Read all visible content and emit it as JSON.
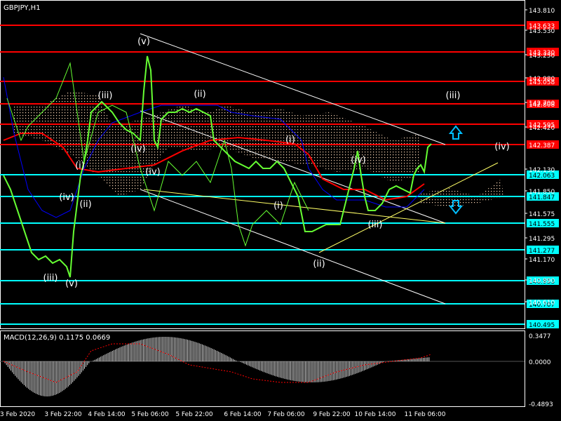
{
  "symbol_title": "GBPJPY,H1",
  "main_price_ticks": [
    "143.810",
    "143.530",
    "143.250",
    "142.980",
    "142.700",
    "142.420",
    "142.130",
    "141.850",
    "141.575",
    "141.295",
    "141.170",
    "140.890",
    "140.610"
  ],
  "level_lines": [
    {
      "price": "143.633",
      "color": "#ff0000"
    },
    {
      "price": "143.330",
      "color": "#ff0000"
    },
    {
      "price": "143.058",
      "color": "#ff0000"
    },
    {
      "price": "142.808",
      "color": "#ff0000"
    },
    {
      "price": "142.595",
      "color": "#ff0000"
    },
    {
      "price": "142.387",
      "color": "#ff0000"
    },
    {
      "price": "142.063",
      "color": "#00ffff"
    },
    {
      "price": "141.847",
      "color": "#00ffff"
    },
    {
      "price": "141.555",
      "color": "#00ffff"
    },
    {
      "price": "141.277",
      "color": "#00ffff"
    },
    {
      "price": "140.953",
      "color": "#00ffff"
    },
    {
      "price": "140.707",
      "color": "#00ffff"
    },
    {
      "price": "140.495",
      "color": "#00ffff"
    }
  ],
  "wave_labels": [
    "(v)",
    "(iii)",
    "(ii)",
    "(iv)",
    "(i)",
    "(iv)",
    "(iii)",
    "(v)",
    "(ii)",
    "(iv)",
    "(i)",
    "(iv)",
    "(i)",
    "(ii)",
    "(iii)",
    "(v)",
    "(iii)",
    "(iv)"
  ],
  "macd": {
    "label": "MACD(12,26,9) 0.1175 0.0669",
    "ticks": [
      "0.3477",
      "0.0000",
      "-0.4893"
    ]
  },
  "time_labels": [
    "3 Feb 2020",
    "3 Feb 22:00",
    "4 Feb 14:00",
    "5 Feb 06:00",
    "5 Feb 22:00",
    "6 Feb 14:00",
    "7 Feb 06:00",
    "9 Feb 22:00",
    "10 Feb 14:00",
    "11 Feb 06:00"
  ],
  "colors": {
    "background": "#000000",
    "grid": "#ffffff",
    "price": "#66ff33",
    "ichimoku_cloud": "#ffdab9",
    "kijun": "#ff0000",
    "tenkan": "#0000ff",
    "trendline": "#ffffff",
    "yellow_line": "#ffff66",
    "arrow": "#00bfff"
  },
  "icons": [
    "arrow-up-icon",
    "arrow-down-icon"
  ]
}
